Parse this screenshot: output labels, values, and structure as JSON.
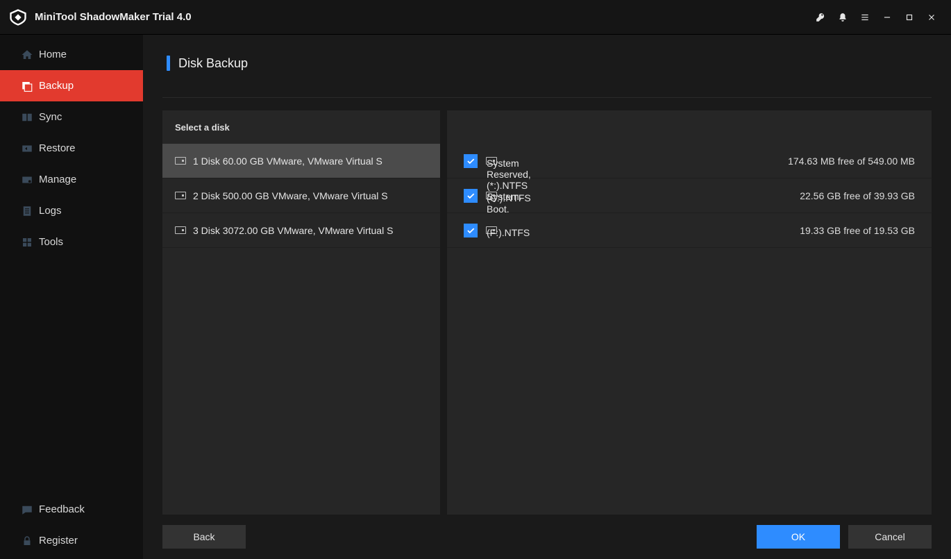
{
  "app": {
    "title": "MiniTool ShadowMaker Trial 4.0"
  },
  "sidebar": {
    "items": [
      {
        "label": "Home"
      },
      {
        "label": "Backup"
      },
      {
        "label": "Sync"
      },
      {
        "label": "Restore"
      },
      {
        "label": "Manage"
      },
      {
        "label": "Logs"
      },
      {
        "label": "Tools"
      }
    ],
    "bottom": [
      {
        "label": "Feedback"
      },
      {
        "label": "Register"
      }
    ]
  },
  "page": {
    "title": "Disk Backup",
    "select_label": "Select a disk"
  },
  "disks": [
    {
      "label": "1 Disk 60.00 GB VMware,  VMware Virtual S",
      "selected": true
    },
    {
      "label": "2 Disk 500.00 GB VMware,  VMware Virtual S",
      "selected": false
    },
    {
      "label": "3 Disk 3072.00 GB VMware,  VMware Virtual S",
      "selected": false
    }
  ],
  "partitions": [
    {
      "name": "System Reserved,(*:).NTFS System.",
      "free": "174.63 MB free of 549.00 MB",
      "checked": true
    },
    {
      "name": "(C:).NTFS Boot.",
      "free": "22.56 GB free of 39.93 GB",
      "checked": true
    },
    {
      "name": "(F:).NTFS",
      "free": "19.33 GB free of 19.53 GB",
      "checked": true
    }
  ],
  "buttons": {
    "back": "Back",
    "ok": "OK",
    "cancel": "Cancel"
  }
}
